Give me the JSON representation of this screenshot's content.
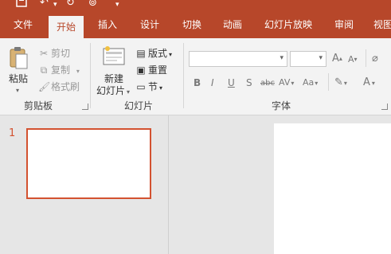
{
  "qat": {
    "save_icon": "save-icon",
    "undo_icon": "undo-icon",
    "redo_icon": "redo-icon",
    "present_icon": "present-icon",
    "customize_icon": "customize-icon"
  },
  "tabs": [
    "文件",
    "开始",
    "插入",
    "设计",
    "切换",
    "动画",
    "幻灯片放映",
    "审阅",
    "视图"
  ],
  "active_tab_index": 1,
  "clipboard": {
    "paste_label": "粘贴",
    "cut_label": "剪切",
    "copy_label": "复制",
    "format_painter_label": "格式刷",
    "group_label": "剪贴板"
  },
  "slides": {
    "new_slide_line1": "新建",
    "new_slide_line2": "幻灯片",
    "layout_label": "版式",
    "reset_label": "重置",
    "section_label": "节",
    "group_label": "幻灯片"
  },
  "font": {
    "font_name_value": "",
    "font_size_value": "",
    "grow_label": "A",
    "shrink_label": "A",
    "bold": "B",
    "italic": "I",
    "underline": "U",
    "shadow": "S",
    "strike": "abc",
    "spacing": "AV",
    "case": "Aa",
    "color": "A",
    "group_label": "字体"
  },
  "thumbnails": {
    "slide_number": "1"
  },
  "colors": {
    "accent": "#b7472a",
    "selection": "#d35230"
  }
}
